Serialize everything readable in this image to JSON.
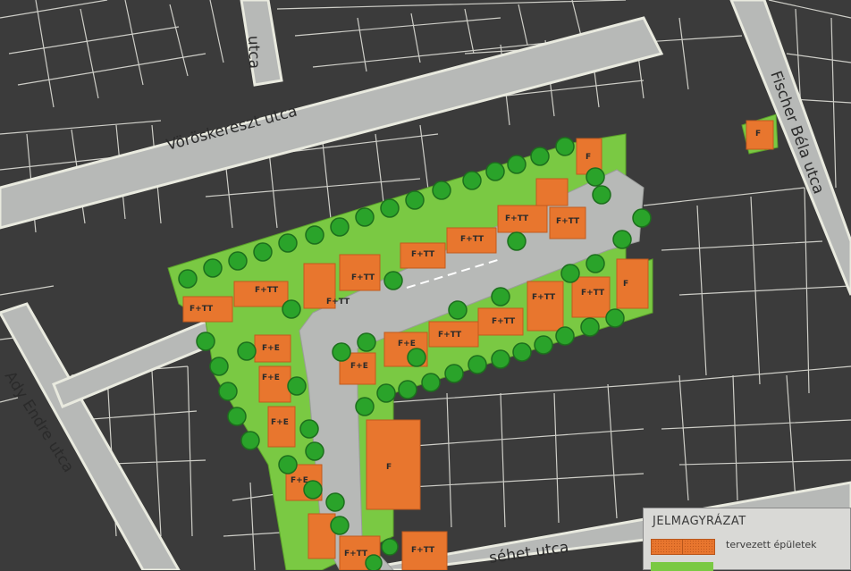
{
  "streets": {
    "top_left": "utca",
    "voroskereszt": "Vöröskereszt utca",
    "fischer": "Fischer Béla utca",
    "ady": "Ady Endre utca",
    "bottom": "séhet utca"
  },
  "plots": {
    "labels_ftt": "F+TT",
    "labels_fe": "F+E",
    "labels_f": "F"
  },
  "legend": {
    "title": "JELMAGYRÁZAT",
    "item_label": "tervezett épületek"
  },
  "colors": {
    "background": "#3a3a3a",
    "street": "#b7b9b7",
    "green_area": "#7ac943",
    "planned_building": "#e8762e",
    "tree": "#2aa32a"
  }
}
